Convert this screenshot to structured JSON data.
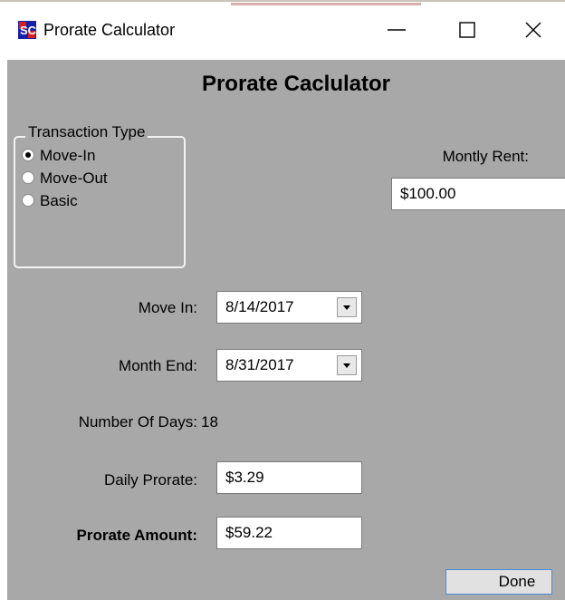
{
  "window": {
    "title": "Prorate Calculator",
    "icon": "app-logo-icon",
    "controls": [
      "minimize-icon",
      "maximize-icon",
      "close-icon"
    ]
  },
  "form": {
    "heading": "Prorate Caclulator",
    "transaction_type": {
      "legend": "Transaction Type",
      "options": [
        {
          "label": "Move-In",
          "selected": true
        },
        {
          "label": "Move-Out",
          "selected": false
        },
        {
          "label": "Basic",
          "selected": false
        }
      ]
    },
    "monthly_rent": {
      "label": "Montly Rent:",
      "value": "$100.00"
    },
    "move_in": {
      "label": "Move In:",
      "value": "8/14/2017"
    },
    "month_end": {
      "label": "Month End:",
      "value": "8/31/2017"
    },
    "number_of_days": {
      "label": "Number Of Days:",
      "value": "18"
    },
    "daily_prorate": {
      "label": "Daily Prorate:",
      "value": "$3.29"
    },
    "prorate_amount": {
      "label": "Prorate Amount:",
      "value": "$59.22"
    },
    "done_label": "Done"
  },
  "colors": {
    "form_background": "#a8a8a8",
    "titlebar_background": "#ffffff",
    "done_border": "#4a8ad6"
  }
}
